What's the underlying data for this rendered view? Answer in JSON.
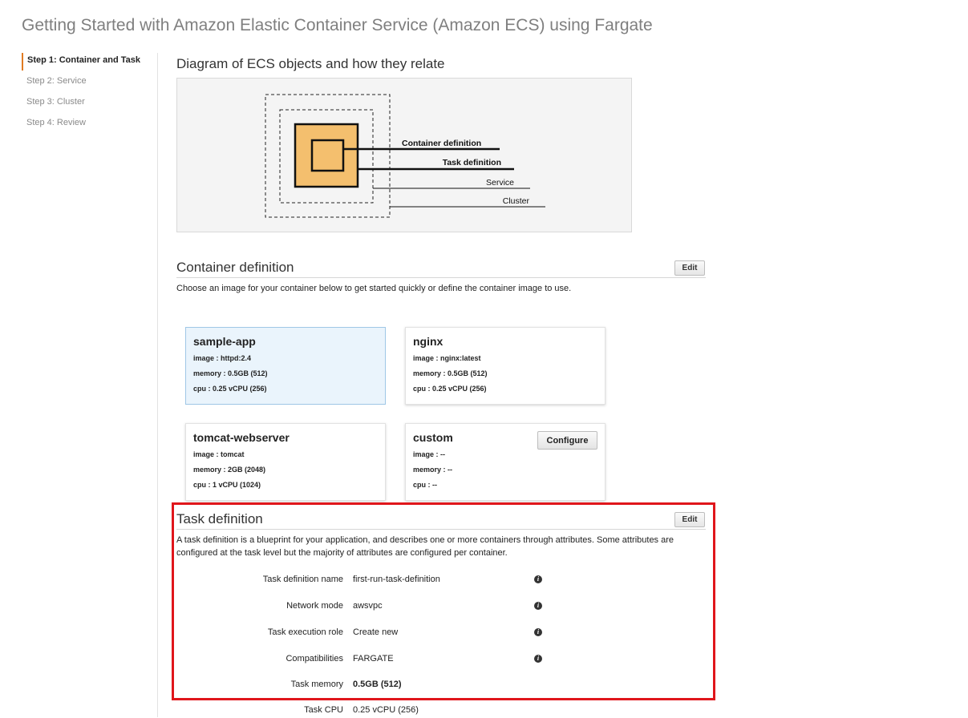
{
  "page": {
    "title": "Getting Started with Amazon Elastic Container Service (Amazon ECS) using Fargate"
  },
  "sidebar": {
    "items": [
      {
        "label": "Step 1: Container and Task"
      },
      {
        "label": "Step 2: Service"
      },
      {
        "label": "Step 3: Cluster"
      },
      {
        "label": "Step 4: Review"
      }
    ]
  },
  "diagram": {
    "title": "Diagram of ECS objects and how they relate",
    "labels": {
      "container": "Container definition",
      "task": "Task definition",
      "service": "Service",
      "cluster": "Cluster"
    },
    "colors": {
      "fill": "#f4bf6e",
      "background": "#f4f4f4"
    }
  },
  "container_definition": {
    "title": "Container definition",
    "edit_label": "Edit",
    "description": "Choose an image for your container below to get started quickly or define the container image to use.",
    "cards": [
      {
        "name": "sample-app",
        "image": "image : httpd:2.4",
        "memory": "memory :  0.5GB (512)",
        "cpu": "cpu :  0.25 vCPU (256)"
      },
      {
        "name": "nginx",
        "image": "image : nginx:latest",
        "memory": "memory :  0.5GB (512)",
        "cpu": "cpu :  0.25 vCPU (256)"
      },
      {
        "name": "tomcat-webserver",
        "image": "image : tomcat",
        "memory": "memory :  2GB (2048)",
        "cpu": "cpu :  1 vCPU (1024)"
      },
      {
        "name": "custom",
        "image": "image : --",
        "memory": "memory :  --",
        "cpu": "cpu :  --",
        "configure_label": "Configure"
      }
    ]
  },
  "task_definition": {
    "title": "Task definition",
    "edit_label": "Edit",
    "description": "A task definition is a blueprint for your application, and describes one or more containers through attributes. Some attributes are configured at the task level but the majority of attributes are configured per container.",
    "fields": [
      {
        "label": "Task definition name",
        "value": "first-run-task-definition",
        "info": true
      },
      {
        "label": "Network mode",
        "value": "awsvpc",
        "info": true
      },
      {
        "label": "Task execution role",
        "value": "Create new",
        "info": true
      },
      {
        "label": "Compatibilities",
        "value": "FARGATE",
        "info": true
      },
      {
        "label": "Task memory",
        "value": "0.5GB (512)",
        "info": false
      }
    ],
    "cut_field": {
      "label": "Task CPU",
      "value": "0.25 vCPU (256)"
    }
  },
  "colors": {
    "highlight": "#e0161b",
    "accent": "#e07b22",
    "selected_card": "#eaf4fc"
  }
}
